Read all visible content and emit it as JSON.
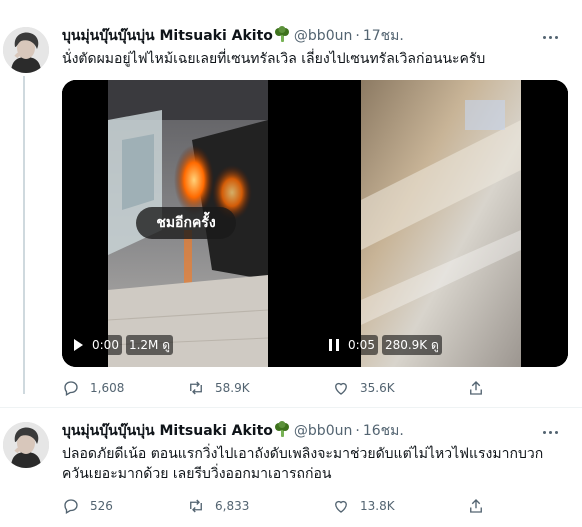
{
  "tweets": [
    {
      "display_name": "บุนมุ่นบุ๊นบุ๊นบุ่น Mitsuaki Akito",
      "handle": "@bb0un",
      "separator": "·",
      "time": "17ชม.",
      "text": "นั่งตัดผมอยู่ไฟไหม้เฉยเลยที่เซนทรัลเวิล เลี่ยงไปเซนทรัลเวิลก่อนนะครับ",
      "videos": [
        {
          "overlay": "ชมอีกครั้ง",
          "state": "paused",
          "time": "0:00",
          "views": "1.2M ดู"
        },
        {
          "state": "playing",
          "time": "0:05",
          "views": "280.9K ดู"
        }
      ],
      "stats": {
        "replies": "1,608",
        "retweets": "58.9K",
        "likes": "35.6K"
      }
    },
    {
      "display_name": "บุนมุ่นบุ๊นบุ๊นบุ่น Mitsuaki Akito",
      "handle": "@bb0un",
      "separator": "·",
      "time": "16ชม.",
      "text": "ปลอดภัยดีเน้อ ตอนแรกวิ่งไปเอาถังดับเพลิงจะมาช่วยดับแต่ไม่ไหวไฟแรงมากบวกควันเยอะมากด้วย เลยรีบวิ่งออกมาเอารถก่อน",
      "stats": {
        "replies": "526",
        "retweets": "6,833",
        "likes": "13.8K"
      }
    }
  ],
  "icons": {
    "name_emoji": "broccoli-icon",
    "reply": "reply-icon",
    "retweet": "retweet-icon",
    "like": "like-icon",
    "share": "share-icon",
    "more": "more-icon"
  },
  "colors": {
    "secondary_text": "#536471",
    "primary_text": "#0f1419",
    "thread_line": "#cfd9de",
    "fire": "#ff6a00"
  }
}
